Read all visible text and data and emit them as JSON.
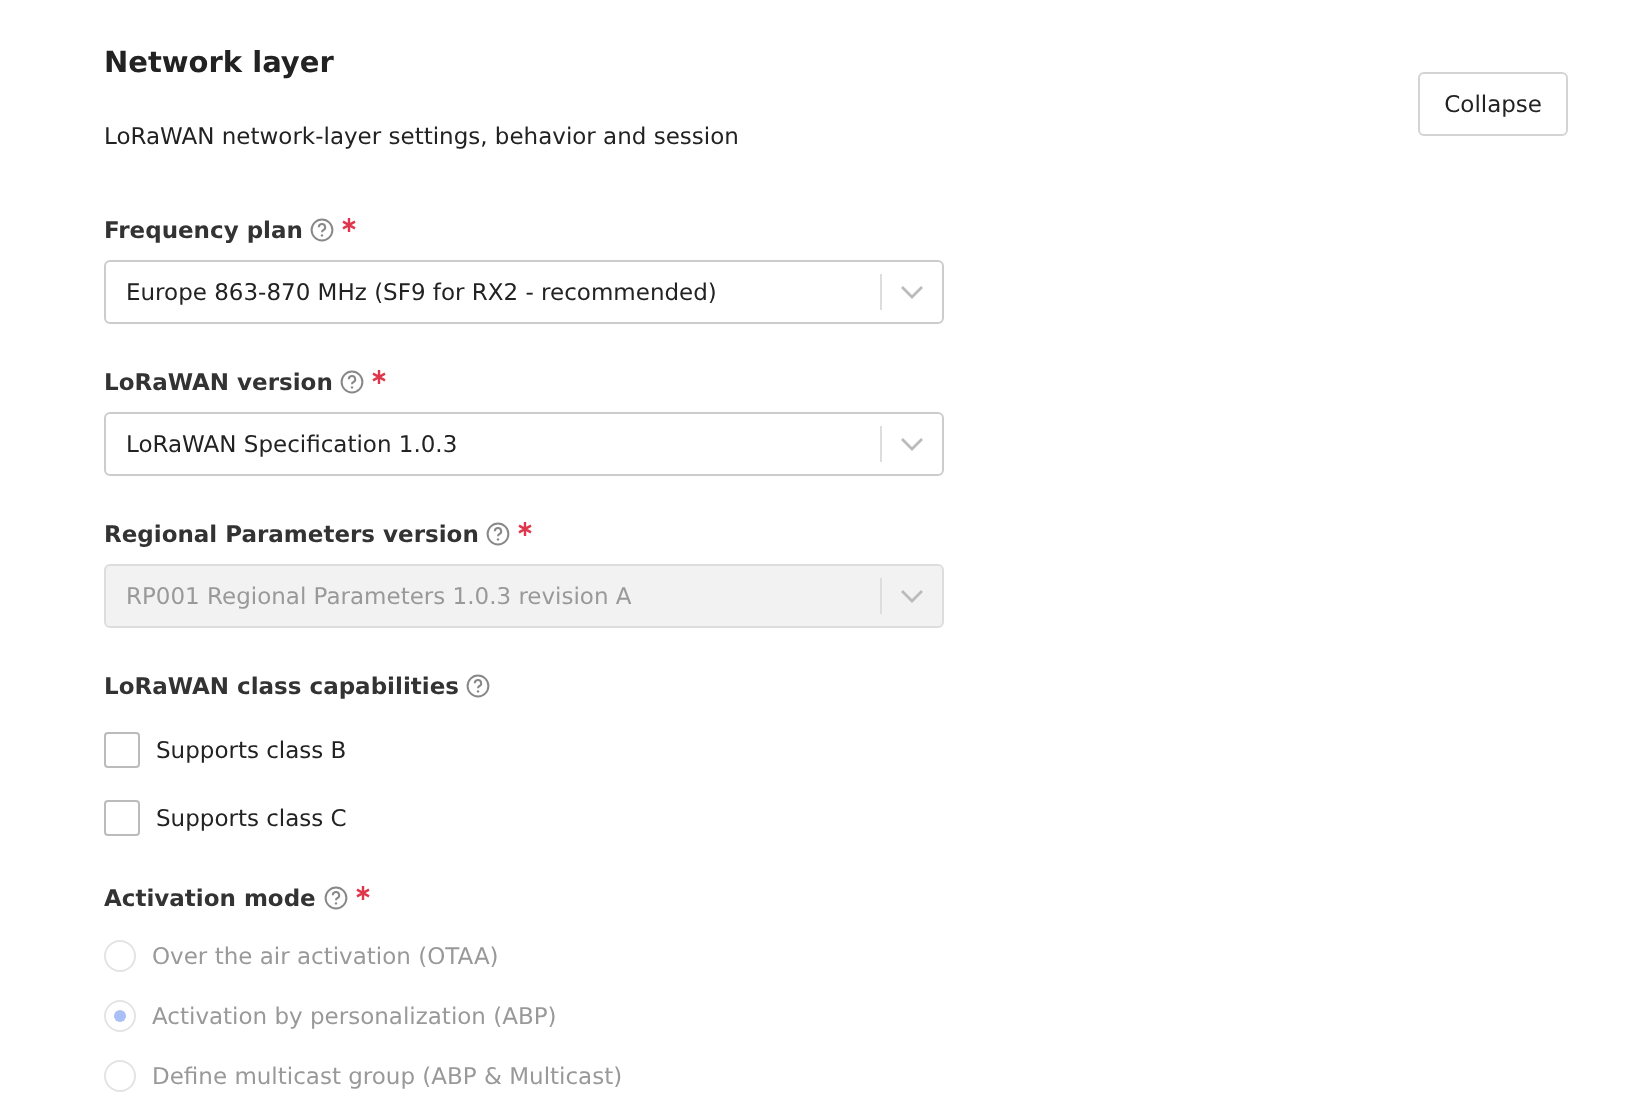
{
  "section": {
    "title": "Network layer",
    "description": "LoRaWAN network-layer settings, behavior and session",
    "collapse_button": "Collapse"
  },
  "fields": [
    {
      "kind": "select",
      "label": "Frequency plan",
      "help": true,
      "required": true,
      "value": "Europe 863-870 MHz (SF9 for RX2 - recommended)",
      "disabled": false
    },
    {
      "kind": "select",
      "label": "LoRaWAN version",
      "help": true,
      "required": true,
      "value": "LoRaWAN Specification 1.0.3",
      "disabled": false
    },
    {
      "kind": "select",
      "label": "Regional Parameters version",
      "help": true,
      "required": true,
      "value": "RP001 Regional Parameters 1.0.3 revision A",
      "disabled": true
    },
    {
      "kind": "checkboxes",
      "label": "LoRaWAN class capabilities",
      "help": true,
      "required": false,
      "options": [
        {
          "label": "Supports class B",
          "checked": false
        },
        {
          "label": "Supports class C",
          "checked": false
        }
      ]
    },
    {
      "kind": "radios",
      "label": "Activation mode",
      "help": true,
      "required": true,
      "disabled": true,
      "options": [
        {
          "label": "Over the air activation (OTAA)",
          "selected": false
        },
        {
          "label": "Activation by personalization (ABP)",
          "selected": true
        },
        {
          "label": "Define multicast group (ABP & Multicast)",
          "selected": false
        }
      ]
    }
  ]
}
